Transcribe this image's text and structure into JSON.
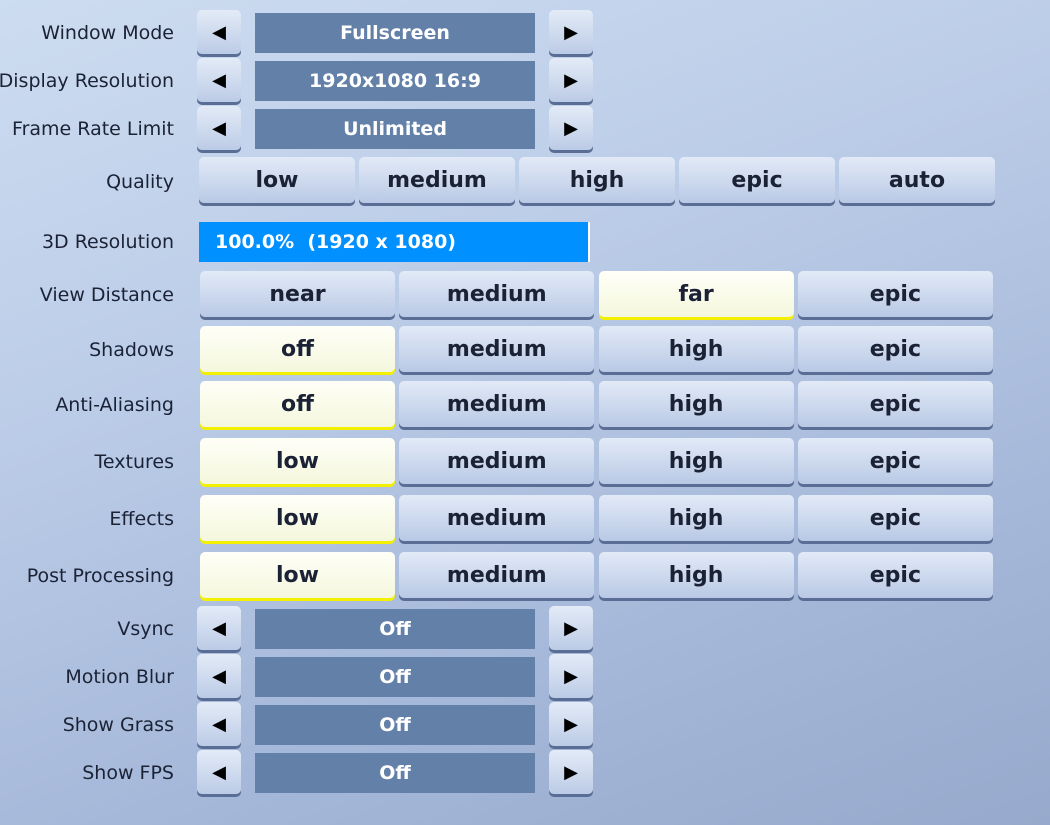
{
  "arrow_rows_top": [
    {
      "label": "Window Mode",
      "value": "Fullscreen"
    },
    {
      "label": "Display Resolution",
      "value": "1920x1080 16:9"
    },
    {
      "label": "Frame Rate Limit",
      "value": "Unlimited"
    }
  ],
  "quality": {
    "label": "Quality",
    "options": [
      "low",
      "medium",
      "high",
      "epic",
      "auto"
    ],
    "selected": null
  },
  "resolution_3d": {
    "label": "3D Resolution",
    "text": "100.0%  (1920 x 1080)",
    "percent": 100,
    "fill_color": "#0090ff"
  },
  "option_rows": [
    {
      "label": "View Distance",
      "options": [
        "near",
        "medium",
        "far",
        "epic"
      ],
      "selected": 2
    },
    {
      "label": "Shadows",
      "options": [
        "off",
        "medium",
        "high",
        "epic"
      ],
      "selected": 0
    },
    {
      "label": "Anti-Aliasing",
      "options": [
        "off",
        "medium",
        "high",
        "epic"
      ],
      "selected": 0
    },
    {
      "label": "Textures",
      "options": [
        "low",
        "medium",
        "high",
        "epic"
      ],
      "selected": 0
    },
    {
      "label": "Effects",
      "options": [
        "low",
        "medium",
        "high",
        "epic"
      ],
      "selected": 0
    },
    {
      "label": "Post Processing",
      "options": [
        "low",
        "medium",
        "high",
        "epic"
      ],
      "selected": 0
    }
  ],
  "arrow_rows_bottom": [
    {
      "label": "Vsync",
      "value": "Off"
    },
    {
      "label": "Motion Blur",
      "value": "Off"
    },
    {
      "label": "Show Grass",
      "value": "Off"
    },
    {
      "label": "Show FPS",
      "value": "Off"
    }
  ],
  "icons": {
    "left": "◀",
    "right": "▶"
  },
  "colors": {
    "selected_underline": "#f2f000",
    "value_box": "#6380a8"
  }
}
